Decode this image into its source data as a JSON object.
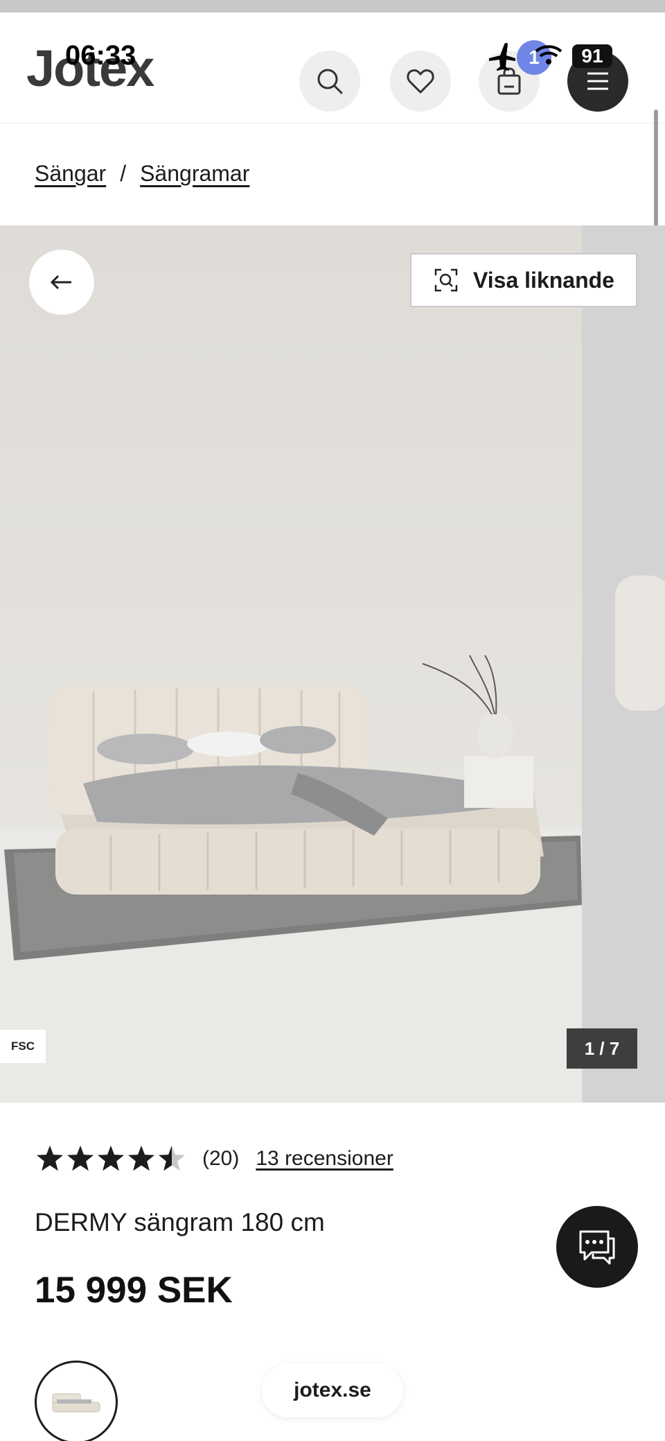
{
  "status_bar": {
    "time": "06:33",
    "notification_count": "1",
    "battery": "91"
  },
  "header": {
    "logo": "Jotex"
  },
  "breadcrumb": {
    "items": [
      {
        "label": "Sängar"
      },
      {
        "label": "Sängramar"
      }
    ],
    "separator": "/"
  },
  "gallery": {
    "similar_label": "Visa liknande",
    "fsc_label": "FSC",
    "counter": "1 / 7"
  },
  "product": {
    "rating_value": 4.5,
    "rating_count": "(20)",
    "reviews_link": "13 recensioner",
    "title": "DERMY sängram 180 cm",
    "price": "15 999 SEK"
  },
  "footer": {
    "url": "jotex.se"
  },
  "colors": {
    "background": "#ffffff",
    "accent_dark": "#1a1a1a",
    "image_backdrop": "#dcdad7",
    "notification_badge": "#6f86e6"
  }
}
